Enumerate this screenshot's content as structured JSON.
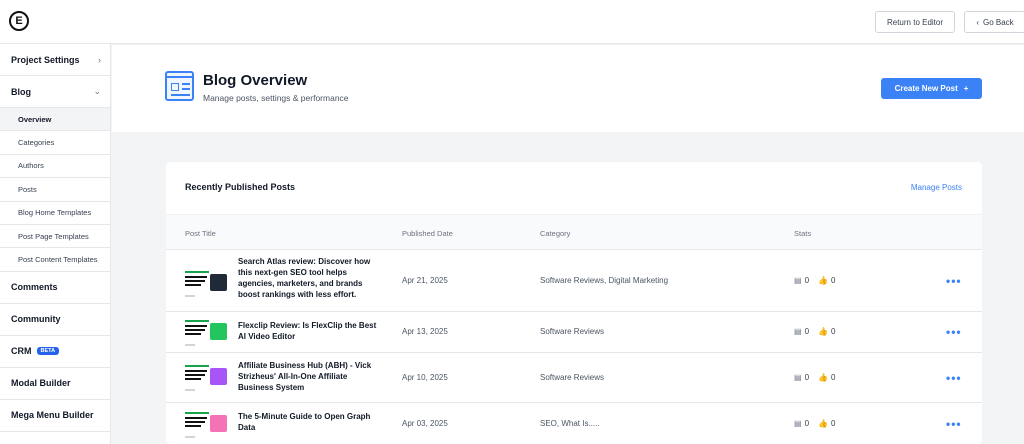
{
  "topbar": {
    "logo_letter": "E",
    "return_label": "Return to Editor",
    "back_label": "Go Back",
    "back_icon": "chevron-left-icon"
  },
  "sidebar": {
    "sections": [
      {
        "label": "Project Settings",
        "chevron": "›"
      },
      {
        "label": "Blog",
        "chevron": "⌄"
      }
    ],
    "blog_items": [
      "Overview",
      "Categories",
      "Authors",
      "Posts",
      "Blog Home Templates",
      "Post Page Templates",
      "Post Content Templates"
    ],
    "lower_sections": [
      "Comments",
      "Community",
      "CRM",
      "Modal Builder",
      "Mega Menu Builder"
    ],
    "crm_badge": "BETA"
  },
  "header": {
    "title": "Blog Overview",
    "subtitle": "Manage posts, settings & performance",
    "create_label": "Create New Post",
    "create_icon": "+"
  },
  "recent": {
    "title": "Recently Published Posts",
    "manage_link": "Manage Posts",
    "columns": [
      "Post Title",
      "Published Date",
      "Category",
      "Stats"
    ],
    "rows": [
      {
        "title": "Search Atlas review: Discover how this next-gen SEO tool helps agencies, marketers, and brands boost rankings with less effort.",
        "date": "Apr 21, 2025",
        "category": "Software Reviews,  Digital Marketing",
        "comments": "0",
        "likes": "0"
      },
      {
        "title": "Flexclip Review: Is FlexClip the Best AI Video Editor",
        "date": "Apr 13, 2025",
        "category": "Software Reviews",
        "comments": "0",
        "likes": "0"
      },
      {
        "title": "Affiliate Business Hub (ABH) - Vick Strizheus' All-In-One Affiliate Business System",
        "date": "Apr 10, 2025",
        "category": "Software Reviews",
        "comments": "0",
        "likes": "0"
      },
      {
        "title": "The 5-Minute Guide to Open Graph Data",
        "date": "Apr 03, 2025",
        "category": "SEO,  What Is.....",
        "comments": "0",
        "likes": "0"
      }
    ]
  },
  "colors": {
    "accent": "#3b82f6",
    "thumb_green": "#16a34a"
  }
}
